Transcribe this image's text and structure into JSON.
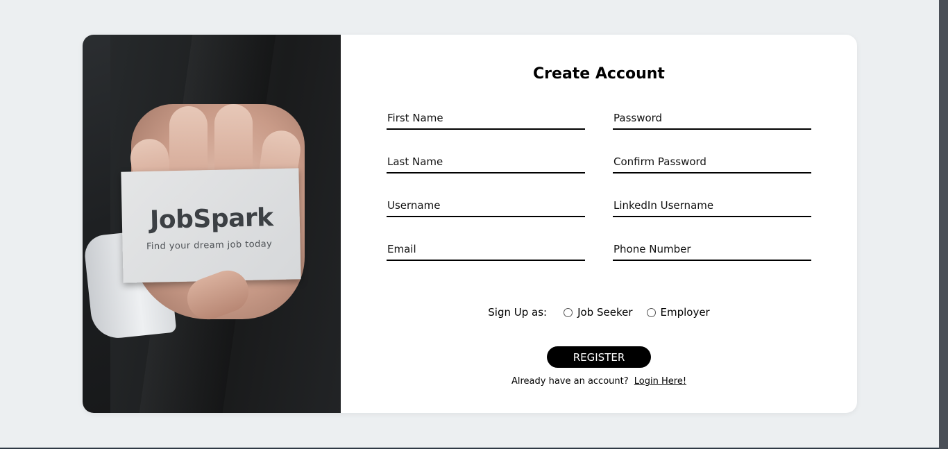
{
  "hero": {
    "brand": "JobSpark",
    "tagline": "Find your dream job today"
  },
  "form": {
    "title": "Create Account",
    "fields": {
      "first_name": {
        "placeholder": "First Name",
        "value": ""
      },
      "password": {
        "placeholder": "Password",
        "value": ""
      },
      "last_name": {
        "placeholder": "Last Name",
        "value": ""
      },
      "confirm_password": {
        "placeholder": "Confirm Password",
        "value": ""
      },
      "username": {
        "placeholder": "Username",
        "value": ""
      },
      "linkedin_username": {
        "placeholder": "LinkedIn Username",
        "value": ""
      },
      "email": {
        "placeholder": "Email",
        "value": ""
      },
      "phone_number": {
        "placeholder": "Phone Number",
        "value": ""
      }
    },
    "signup_as": {
      "label": "Sign Up as:",
      "options": [
        "Job Seeker",
        "Employer"
      ]
    },
    "register_label": "REGISTER",
    "login_prompt": "Already have an account?",
    "login_link": "Login Here!"
  },
  "colors": {
    "background": "#eceff1",
    "card": "#ffffff",
    "button": "#000000"
  }
}
